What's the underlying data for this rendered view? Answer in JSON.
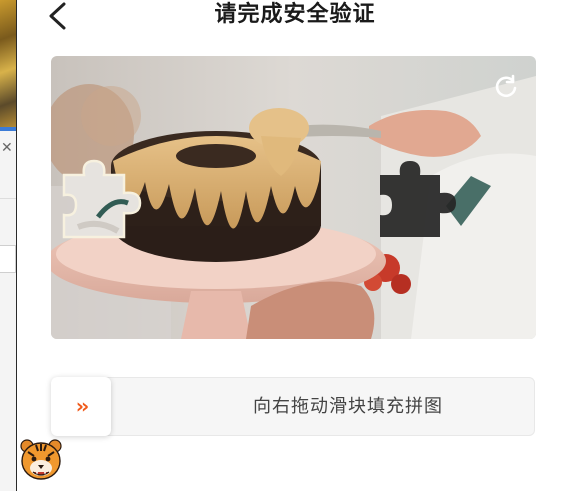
{
  "header": {
    "title": "请完成安全验证",
    "back_icon": "chevron-left-icon"
  },
  "puzzle": {
    "refresh_icon": "refresh-icon"
  },
  "slider": {
    "handle_glyph": "››",
    "hint": "向右拖动滑块填充拼图",
    "accent_color": "#f05a1a"
  },
  "background_page": {
    "close_glyph": "✕"
  },
  "mascot": {
    "icon": "tiger-avatar-icon"
  }
}
